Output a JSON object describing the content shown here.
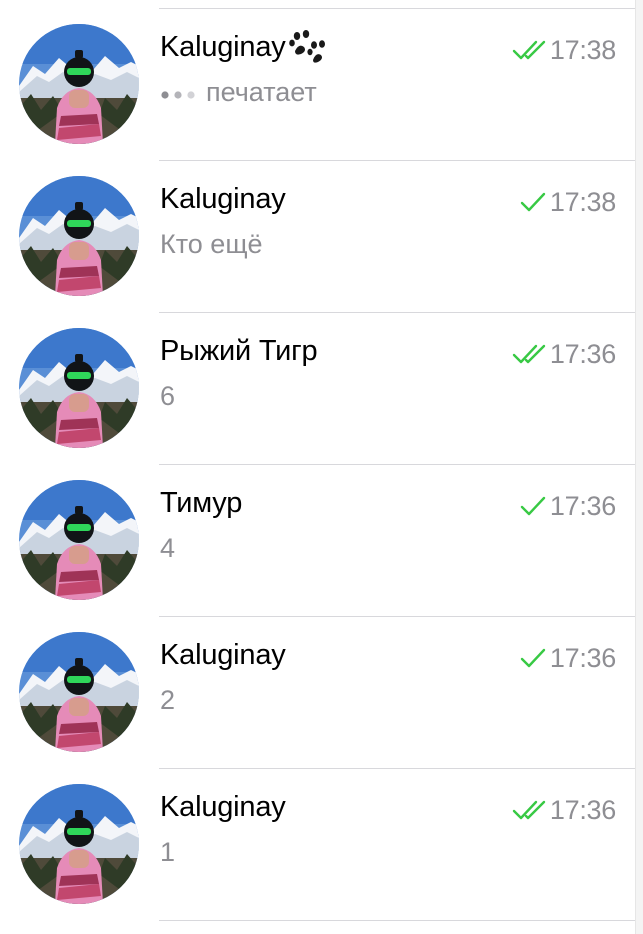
{
  "chats": [
    {
      "name": "Kaluginay",
      "preview": "печатает",
      "time": "17:38",
      "status": "double-check",
      "typing": true,
      "name_icon": "paw-prints-icon"
    },
    {
      "name": "Kaluginay",
      "preview": "Кто ещё",
      "time": "17:38",
      "status": "single-check",
      "typing": false
    },
    {
      "name": "Рыжий Тигр",
      "preview": "6",
      "time": "17:36",
      "status": "double-check",
      "typing": false
    },
    {
      "name": "Тимур",
      "preview": "4",
      "time": "17:36",
      "status": "single-check",
      "typing": false
    },
    {
      "name": "Kaluginay",
      "preview": "2",
      "time": "17:36",
      "status": "single-check",
      "typing": false
    },
    {
      "name": "Kaluginay",
      "preview": "1",
      "time": "17:36",
      "status": "double-check",
      "typing": false
    }
  ],
  "colors": {
    "check": "#38c944",
    "secondary_text": "#8e8e93",
    "divider": "#d8d8dc"
  }
}
